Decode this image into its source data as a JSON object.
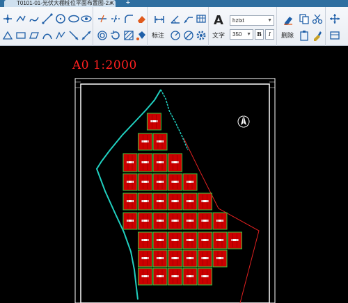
{
  "tab": {
    "title": "T0101-01-光伏大棚桩位平面布置图-2.X",
    "close_glyph": "×",
    "add_glyph": "+"
  },
  "ribbon": {
    "annotate_label": "标注",
    "text_label": "文字",
    "delete_label": "删除",
    "text_style": "hztxt",
    "text_height": "350",
    "bold_glyph": "B",
    "italic_glyph": "I",
    "big_text_glyph": "A"
  },
  "drawing": {
    "scale_text": "A0 1:2000",
    "colors": {
      "frame": "#ffffff",
      "panels": "#cc0000",
      "panel_edges": "#2ecc40",
      "boundary": "#e02020",
      "road": "#20d0c0"
    }
  },
  "icons": [
    "line-icon",
    "polyline-icon",
    "circle-icon",
    "arc-icon",
    "rectangle-icon",
    "hatch-icon",
    "dimension-icon",
    "text-icon",
    "move-icon",
    "copy-icon",
    "erase-icon",
    "layer-icon"
  ]
}
